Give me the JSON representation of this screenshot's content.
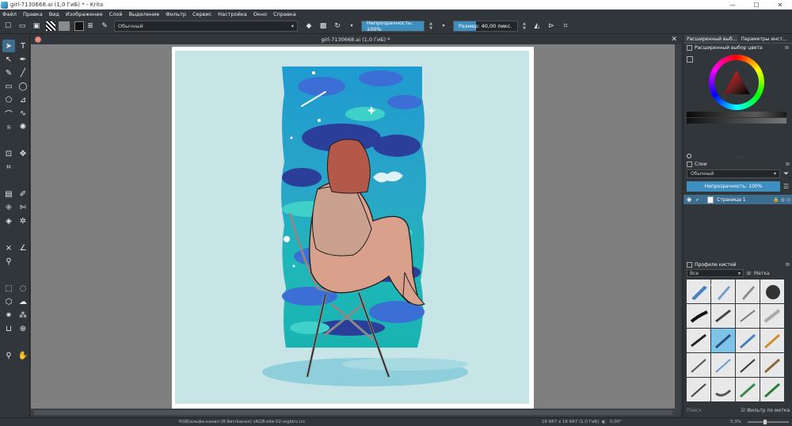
{
  "window": {
    "title": "girl-7130668.ai (1,0 ГиБ) * - Krita",
    "min": "—",
    "max": "☐",
    "close": "✕"
  },
  "menu": [
    "Файл",
    "Правка",
    "Вид",
    "Изображение",
    "Слой",
    "Выделение",
    "Фильтр",
    "Сервис",
    "Настройка",
    "Окно",
    "Справка"
  ],
  "toolbar": {
    "preset": "Обычный",
    "opacity_label": "Непрозрачность: 100%",
    "size_label": "Размер: 40,00 пикс."
  },
  "document": {
    "tab_title": "girl-7130668.ai (1,0 ГиБ) *",
    "close": "✕"
  },
  "docker": {
    "tabs": [
      "Расширенный выб...",
      "Параметры инст..."
    ],
    "color_panel_title": "Расширенный выбор цвета",
    "layers_title": "Слои",
    "blend_mode": "Обычный",
    "layer_opacity": "Непрозрачность:  100%",
    "layers": [
      {
        "name": "Страница 1",
        "visible": true
      }
    ],
    "brushes_title": "Профили кистей",
    "brush_filter_all": "Все",
    "brush_filter_tag": "Метка",
    "brush_search_placeholder": "Поиск",
    "brush_filter_by_tag": "Фильтр по метка"
  },
  "status": {
    "color_info": "RGB/альфа-канал (8-бит/канал)  sRGB-elle-V2-srgbtrc.icc",
    "size_info": "16 667 x 16 667 (1,0 ГиБ)",
    "rotation": "0,00°",
    "zoom": "5,3%"
  },
  "colors": {
    "accent": "#3d8fbf",
    "panel_bg": "#31363b",
    "canvas_bg": "#7f7f7f",
    "artwork_bg": "#c7e4e6"
  }
}
